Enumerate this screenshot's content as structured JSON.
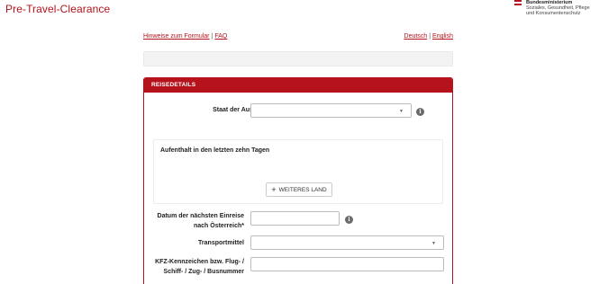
{
  "header": {
    "title": "Pre-Travel-Clearance",
    "brand": {
      "line1": "Bundesministerium",
      "line2": "Soziales, Gesundheit, Pflege",
      "line3": "und Konsumentenschutz"
    }
  },
  "links": {
    "hints": "Hinweise zum Formular",
    "separator": "|",
    "faq": "FAQ",
    "deutsch": "Deutsch",
    "english": "English"
  },
  "panel": {
    "header": "REISEDETAILS",
    "departure_label": "Staat der Ausreise*",
    "departure_value": "",
    "stay_title": "Aufenthalt in den letzten zehn Tagen",
    "add_country_label": "WEITERES LAND",
    "entry_date_label_line1": "Datum der nächsten Einreise",
    "entry_date_label_line2": "nach Österreich*",
    "entry_date_value": "",
    "transport_label": "Transportmittel",
    "transport_value": "",
    "plate_label_line1": "KFZ-Kennzeichen bzw. Flug- /",
    "plate_label_line2": "Schiff- / Zug- / Busnummer",
    "plate_value": ""
  },
  "icons": {
    "info": "i",
    "chevron": "▼",
    "plus": "+"
  },
  "colors": {
    "accent": "#b5121b"
  }
}
